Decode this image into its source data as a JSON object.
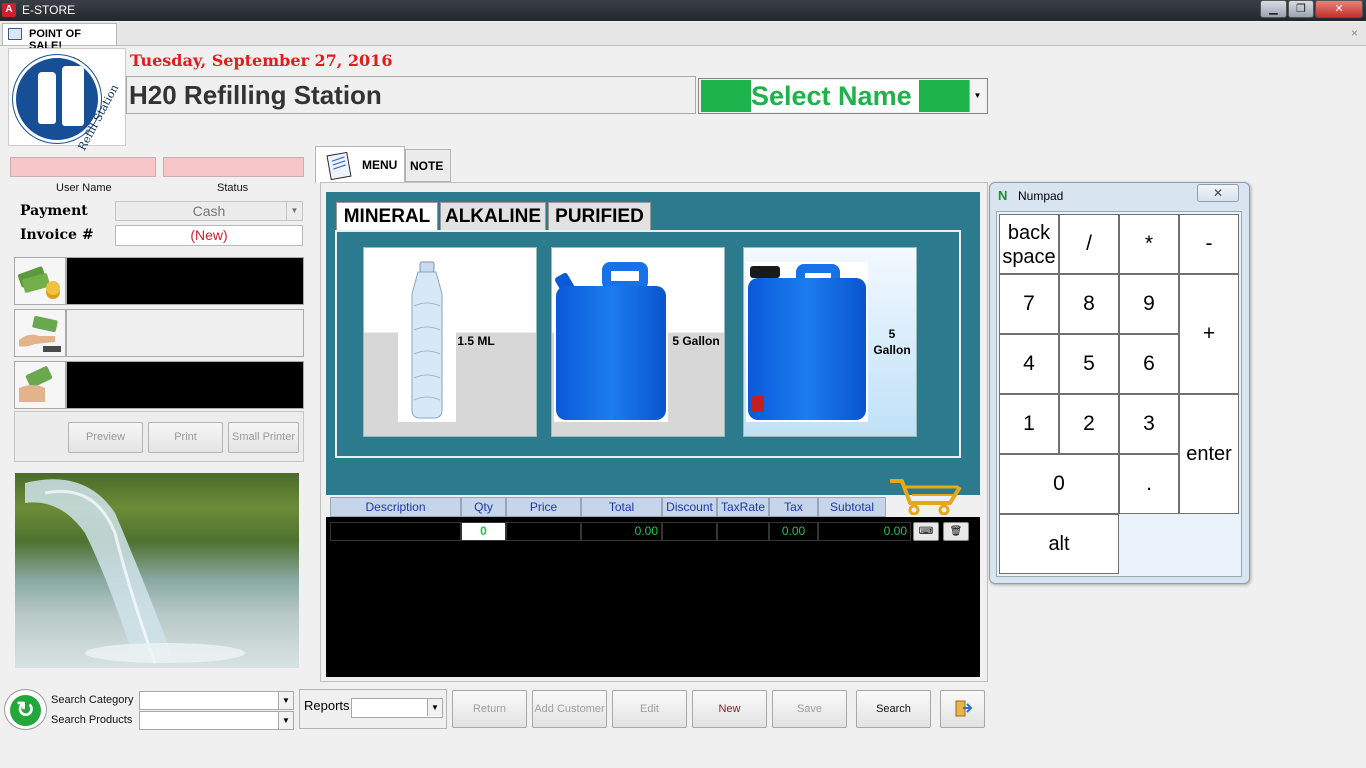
{
  "window": {
    "app_title": "E-STORE",
    "minimize_glyph": "▁",
    "maximize_glyph": "❐",
    "close_glyph": "✕"
  },
  "doc_tab": {
    "label": "POINT OF SALE!",
    "close_glyph": "×"
  },
  "header": {
    "logo_text": "Refill Station",
    "date": "Tuesday, September 27, 2016",
    "station_name": "H20 Refilling Station",
    "select_name": "Select Name",
    "select_name_color": "#1db24a"
  },
  "user_panel": {
    "user_name_label": "User Name",
    "status_label": "Status",
    "payment_label": "Payment",
    "payment_value": "Cash",
    "invoice_label": "Invoice #",
    "invoice_value": "(New)"
  },
  "money_icons": [
    "cash-stack-icon",
    "cash-handover-icon",
    "cash-payment-icon"
  ],
  "actions": {
    "preview": "Preview",
    "print": "Print",
    "small_printer": "Small Printer"
  },
  "tabs": {
    "menu": "MENU",
    "note": "NOTE"
  },
  "category_tabs": [
    "MINERAL",
    "ALKALINE",
    "PURIFIED"
  ],
  "products": [
    {
      "name": "1.5 ML"
    },
    {
      "name": "5 Gallon"
    },
    {
      "name_line1": "5",
      "name_line2": "Gallon"
    }
  ],
  "grid": {
    "columns": [
      "Description",
      "Qty",
      "Price",
      "Total",
      "Discount",
      "TaxRate",
      "Tax",
      "Subtotal"
    ],
    "row": {
      "qty": "0",
      "total": "0.00",
      "tax": "0.00",
      "subtotal": "0.00"
    }
  },
  "bottom": {
    "search_category": "Search Category",
    "search_products": "Search Products",
    "reports": "Reports",
    "buttons": [
      "Return",
      "Add Customer",
      "Edit",
      "New",
      "Save",
      "Search"
    ]
  },
  "numpad": {
    "title": "Numpad",
    "close_glyph": "✕",
    "keys": {
      "backspace_1": "back",
      "backspace_2": "space",
      "slash": "/",
      "star": "*",
      "minus": "-",
      "k7": "7",
      "k8": "8",
      "k9": "9",
      "plus": "+",
      "k4": "4",
      "k5": "5",
      "k6": "6",
      "k1": "1",
      "k2": "2",
      "k3": "3",
      "enter": "enter",
      "k0": "0",
      "dot": ".",
      "alt": "alt"
    }
  },
  "colors": {
    "accent_green": "#1db24a",
    "date_red": "#e31b1b",
    "panel_teal": "#2b7a8e",
    "grid_header": "#c7d5ea"
  }
}
